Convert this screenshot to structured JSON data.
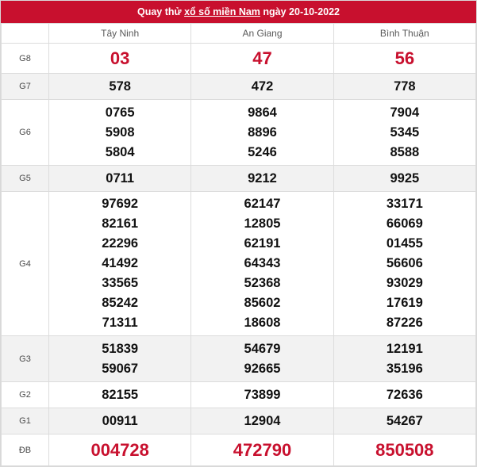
{
  "title": {
    "prefix": "Quay thử ",
    "link": "xổ số miền Nam",
    "suffix": " ngày 20-10-2022"
  },
  "provinces": [
    "Tây Ninh",
    "An Giang",
    "Bình Thuận"
  ],
  "colors": {
    "accent": "#c8102e",
    "shade": "#f2f2f2"
  },
  "rows": [
    {
      "label": "G8",
      "values": [
        [
          "03"
        ],
        [
          "47"
        ],
        [
          "56"
        ]
      ]
    },
    {
      "label": "G7",
      "values": [
        [
          "578"
        ],
        [
          "472"
        ],
        [
          "778"
        ]
      ]
    },
    {
      "label": "G6",
      "values": [
        [
          "0765",
          "5908",
          "5804"
        ],
        [
          "9864",
          "8896",
          "5246"
        ],
        [
          "7904",
          "5345",
          "8588"
        ]
      ]
    },
    {
      "label": "G5",
      "values": [
        [
          "0711"
        ],
        [
          "9212"
        ],
        [
          "9925"
        ]
      ]
    },
    {
      "label": "G4",
      "values": [
        [
          "97692",
          "82161",
          "22296",
          "41492",
          "33565",
          "85242",
          "71311"
        ],
        [
          "62147",
          "12805",
          "62191",
          "64343",
          "52368",
          "85602",
          "18608"
        ],
        [
          "33171",
          "66069",
          "01455",
          "56606",
          "93029",
          "17619",
          "87226"
        ]
      ]
    },
    {
      "label": "G3",
      "values": [
        [
          "51839",
          "59067"
        ],
        [
          "54679",
          "92665"
        ],
        [
          "12191",
          "35196"
        ]
      ]
    },
    {
      "label": "G2",
      "values": [
        [
          "82155"
        ],
        [
          "73899"
        ],
        [
          "72636"
        ]
      ]
    },
    {
      "label": "G1",
      "values": [
        [
          "00911"
        ],
        [
          "12904"
        ],
        [
          "54267"
        ]
      ]
    },
    {
      "label": "ĐB",
      "values": [
        [
          "004728"
        ],
        [
          "472790"
        ],
        [
          "850508"
        ]
      ]
    }
  ]
}
